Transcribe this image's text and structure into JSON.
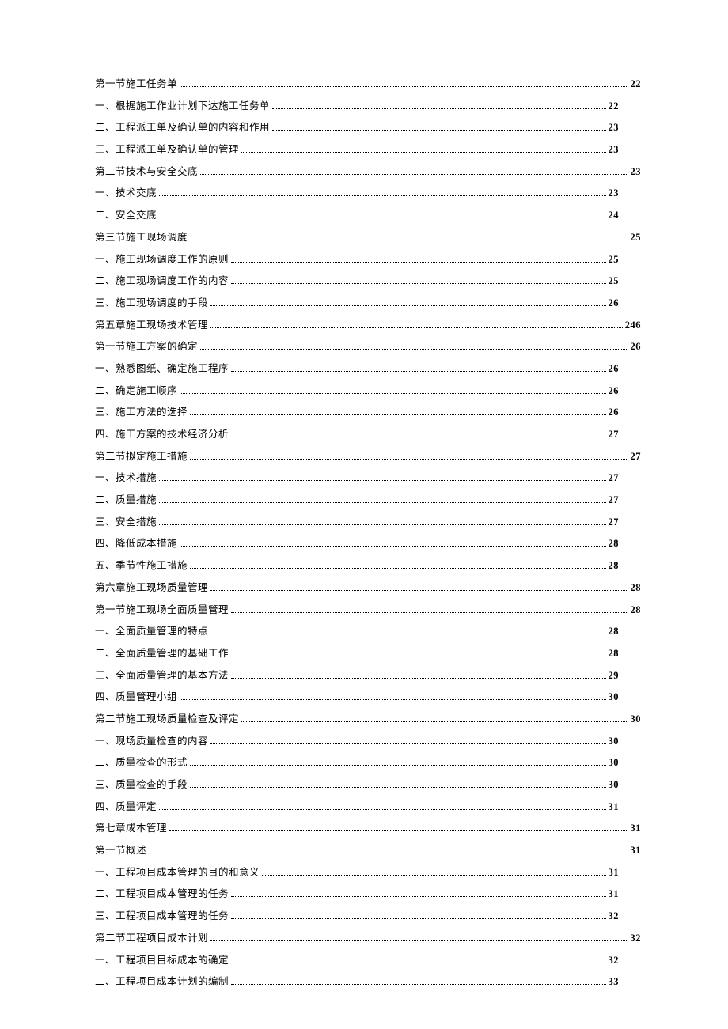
{
  "toc": [
    {
      "title": "第一节施工任务单",
      "page": "22",
      "level": 0,
      "w": "a"
    },
    {
      "title": "一、根据施工作业计划下达施工任务单",
      "page": "22",
      "level": 2,
      "w": "c"
    },
    {
      "title": "二、工程派工单及确认单的内容和作用",
      "page": "23",
      "level": 2,
      "w": "c"
    },
    {
      "title": "三、工程派工单及确认单的管理",
      "page": "23",
      "level": 2,
      "w": "c"
    },
    {
      "title": "第二节技术与安全交底",
      "page": "23",
      "level": 0,
      "w": "a"
    },
    {
      "title": "一、技术交底",
      "page": "23",
      "level": 2,
      "w": "c"
    },
    {
      "title": "二、安全交底",
      "page": "24",
      "level": 2,
      "w": "c"
    },
    {
      "title": "第三节施工现场调度",
      "page": "25",
      "level": 0,
      "w": "a"
    },
    {
      "title": "一、施工现场调度工作的原则",
      "page": "25",
      "level": 2,
      "w": "c"
    },
    {
      "title": "二、施工现场调度工作的内容",
      "page": "25",
      "level": 2,
      "w": "c"
    },
    {
      "title": "三、施工现场调度的手段",
      "page": "26",
      "level": 2,
      "w": "c"
    },
    {
      "title": "第五章施工现场技术管理",
      "page": "246",
      "level": 0,
      "w": "a"
    },
    {
      "title": "第一节施工方案的确定",
      "page": "26",
      "level": 0,
      "w": "a"
    },
    {
      "title": "一、熟悉图纸、确定施工程序",
      "page": "26",
      "level": 2,
      "w": "c"
    },
    {
      "title": "二、确定施工顺序",
      "page": "26",
      "level": 2,
      "w": "c"
    },
    {
      "title": "三、施工方法的选择",
      "page": "26",
      "level": 2,
      "w": "c"
    },
    {
      "title": "四、施工方案的技术经济分析",
      "page": "27",
      "level": 2,
      "w": "c"
    },
    {
      "title": "第二节拟定施工措施",
      "page": "27",
      "level": 0,
      "w": "a"
    },
    {
      "title": "一、技术措施",
      "page": "27",
      "level": 2,
      "w": "c"
    },
    {
      "title": "二、质量措施",
      "page": "27",
      "level": 2,
      "w": "c"
    },
    {
      "title": "三、安全措施",
      "page": "27",
      "level": 2,
      "w": "c"
    },
    {
      "title": "四、降低成本措施",
      "page": "28",
      "level": 2,
      "w": "c"
    },
    {
      "title": "五、季节性施工措施",
      "page": "28",
      "level": 2,
      "w": "c"
    },
    {
      "title": "第六章施工现场质量管理",
      "page": "28",
      "level": 0,
      "w": "a"
    },
    {
      "title": "第一节施工现场全面质量管理",
      "page": "28",
      "level": 0,
      "w": "a"
    },
    {
      "title": "一、全面质量管理的特点",
      "page": "28",
      "level": 2,
      "w": "c"
    },
    {
      "title": "二、全面质量管理的基础工作",
      "page": "28",
      "level": 2,
      "w": "c"
    },
    {
      "title": "三、全面质量管理的基本方法",
      "page": "29",
      "level": 2,
      "w": "c"
    },
    {
      "title": "四、质量管理小组",
      "page": "30",
      "level": 2,
      "w": "c"
    },
    {
      "title": "第二节施工现场质量检查及评定",
      "page": "30",
      "level": 0,
      "w": "a"
    },
    {
      "title": "一、现场质量检查的内容",
      "page": "30",
      "level": 2,
      "w": "c"
    },
    {
      "title": "二、质量检查的形式",
      "page": "30",
      "level": 2,
      "w": "c"
    },
    {
      "title": "三、质量检查的手段",
      "page": "30",
      "level": 2,
      "w": "c"
    },
    {
      "title": "四、质量评定",
      "page": "31",
      "level": 2,
      "w": "c"
    },
    {
      "title": "第七章成本管理",
      "page": "31",
      "level": 0,
      "w": "a"
    },
    {
      "title": "第一节概述",
      "page": "31",
      "level": 0,
      "w": "a"
    },
    {
      "title": "一、工程项目成本管理的目的和意义",
      "page": "31",
      "level": 2,
      "w": "c"
    },
    {
      "title": "二、工程项目成本管理的任务",
      "page": "31",
      "level": 2,
      "w": "c"
    },
    {
      "title": "三、工程项目成本管理的任务",
      "page": "32",
      "level": 2,
      "w": "c"
    },
    {
      "title": "第二节工程项目成本计划",
      "page": "32",
      "level": 0,
      "w": "a"
    },
    {
      "title": "一、工程项目目标成本的确定",
      "page": "32",
      "level": 2,
      "w": "c"
    },
    {
      "title": "二、工程项目成本计划的编制",
      "page": "33",
      "level": 2,
      "w": "c"
    }
  ]
}
